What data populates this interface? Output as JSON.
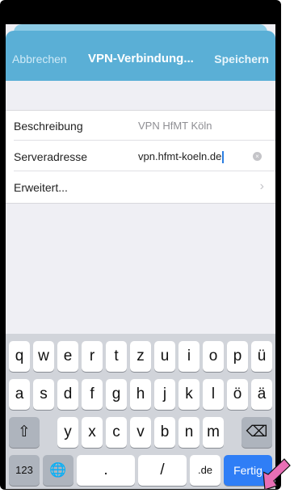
{
  "nav": {
    "cancel": "Abbrechen",
    "title": "VPN-Verbindung...",
    "save": "Speichern"
  },
  "form": {
    "rows": [
      {
        "label": "Beschreibung",
        "value": "VPN HfMT Köln"
      },
      {
        "label": "Serveradresse",
        "value": "vpn.hfmt-koeln.de"
      },
      {
        "label": "Erweitert..."
      }
    ]
  },
  "keyboard": {
    "row1": [
      "q",
      "w",
      "e",
      "r",
      "t",
      "z",
      "u",
      "i",
      "o",
      "p",
      "ü"
    ],
    "row2": [
      "a",
      "s",
      "d",
      "f",
      "g",
      "h",
      "j",
      "k",
      "l",
      "ö",
      "ä"
    ],
    "row3": [
      "y",
      "x",
      "c",
      "v",
      "b",
      "n",
      "m"
    ],
    "row4": {
      "num": "123",
      "dot": ".",
      "slash": "/",
      "de": ".de",
      "done": "Fertig"
    }
  },
  "icons": {
    "globe": "🌐",
    "shift": "⇧",
    "backspace": "⌫",
    "chevron": "›",
    "clear": "×"
  },
  "colors": {
    "nav_bar": "#5aafd6",
    "done_key": "#2f7ef6",
    "arrow": "#e86fb5"
  }
}
